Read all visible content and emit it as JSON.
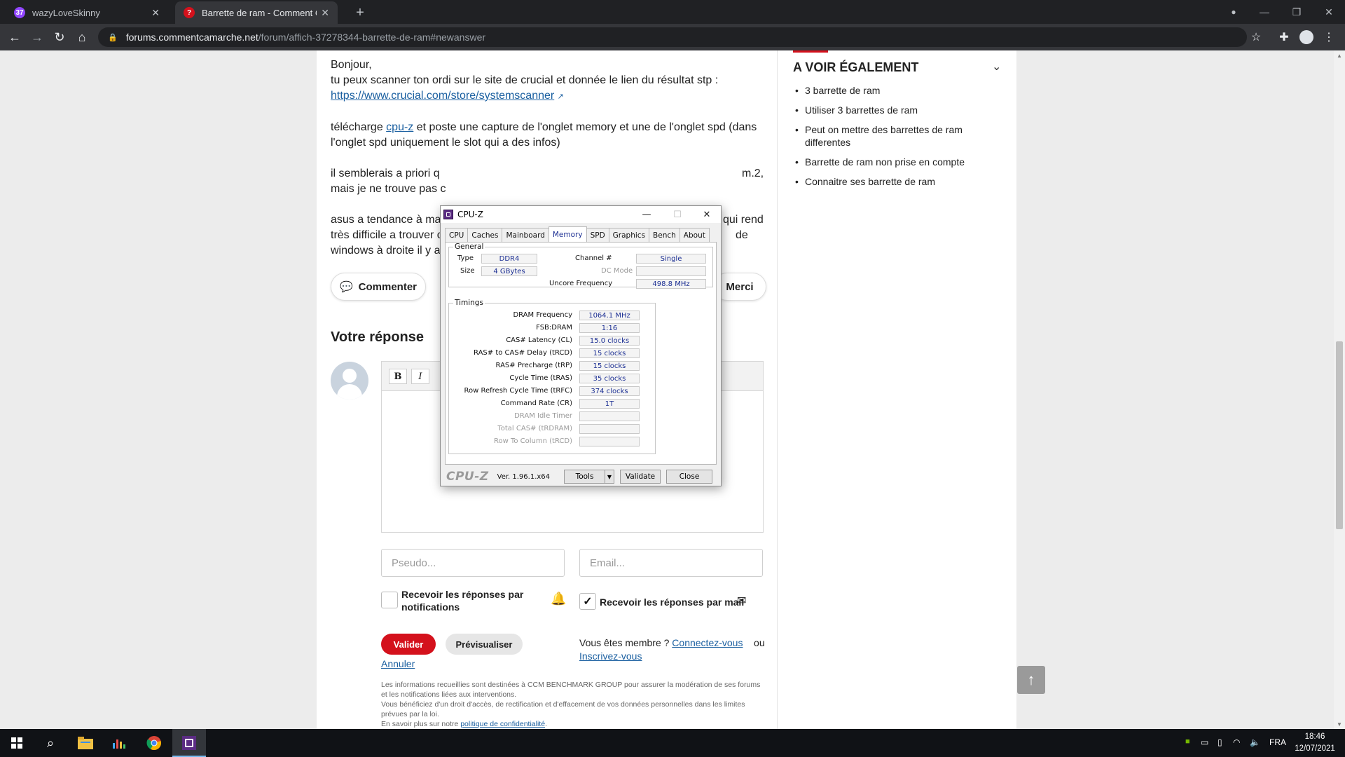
{
  "browser": {
    "tabs": [
      {
        "title": "wazyLoveSkinny",
        "favicon": "twitch-favicon",
        "active": false
      },
      {
        "title": "Barrette de ram - Comment Ça M",
        "favicon": "ccm-favicon",
        "active": true
      }
    ],
    "url_host": "forums.commentcamarche.net",
    "url_path": "/forum/affich-37278344-barrette-de-ram#newanswer"
  },
  "post": {
    "greeting": "Bonjour,",
    "line1": "tu peux scanner ton ordi sur le site de crucial et donnée le lien du résultat stp :",
    "link1": "https://www.crucial.com/store/systemscanner",
    "p2_a": "télécharge ",
    "p2_link": "cpu-z",
    "p2_b": " et poste une capture de l'onglet memory et une de l'onglet spd (dans l'onglet spd uniquement le slot qui a des infos)",
    "p3_a": "il semblerais a priori q",
    "p3_b": "m.2,",
    "p3_c": "mais je ne trouve pas c",
    "p4_a": "asus a tendance à ma",
    "p4_b": "qui rend",
    "p4_c": "très difficile a trouver c",
    "p4_d": "de",
    "p4_e": "windows à droite il y a"
  },
  "actions": {
    "comment": "Commenter",
    "thanks": "Merci"
  },
  "reply": {
    "heading": "Votre réponse",
    "bold": "B",
    "italic": "I",
    "pseudo_placeholder": "Pseudo...",
    "email_placeholder": "Email...",
    "notif_label": "Recevoir les réponses par notifications",
    "mail_label": "Recevoir les réponses par mail",
    "mail_checked": true,
    "submit": "Valider",
    "preview": "Prévisualiser",
    "cancel": "Annuler",
    "member_text": "Vous êtes membre ? ",
    "login": "Connectez-vous",
    "or": "ou",
    "signup": "Inscrivez-vous",
    "legal1": "Les informations recueillies sont destinées à CCM BENCHMARK GROUP pour assurer la modération de ses forums et les notifications liées aux interventions.",
    "legal2": "Vous bénéficiez d'un droit d'accès, de rectification et d'effacement de vos données personnelles dans les limites prévues par la loi.",
    "legal3": "En savoir plus sur notre ",
    "privacy": "politique de confidentialité",
    "legal4": "."
  },
  "sidebar": {
    "title": "A VOIR ÉGALEMENT",
    "items": [
      "3 barrette de ram",
      "Utiliser 3 barrettes de ram",
      "Peut on mettre des barrettes de ram differentes",
      "Barrette de ram non prise en compte",
      "Connaitre ses barrette de ram"
    ]
  },
  "cpuz": {
    "title": "CPU-Z",
    "tabs": [
      "CPU",
      "Caches",
      "Mainboard",
      "Memory",
      "SPD",
      "Graphics",
      "Bench",
      "About"
    ],
    "active_tab": "Memory",
    "general_label": "General",
    "type_label": "Type",
    "type": "DDR4",
    "size_label": "Size",
    "size": "4 GBytes",
    "channel_label": "Channel #",
    "channel": "Single",
    "dcmode_label": "DC Mode",
    "dcmode": "",
    "uncore_label": "Uncore Frequency",
    "uncore": "498.8 MHz",
    "timings_label": "Timings",
    "timings": [
      {
        "label": "DRAM Frequency",
        "value": "1064.1 MHz",
        "enabled": true
      },
      {
        "label": "FSB:DRAM",
        "value": "1:16",
        "enabled": true
      },
      {
        "label": "CAS# Latency (CL)",
        "value": "15.0 clocks",
        "enabled": true
      },
      {
        "label": "RAS# to CAS# Delay (tRCD)",
        "value": "15 clocks",
        "enabled": true
      },
      {
        "label": "RAS# Precharge (tRP)",
        "value": "15 clocks",
        "enabled": true
      },
      {
        "label": "Cycle Time (tRAS)",
        "value": "35 clocks",
        "enabled": true
      },
      {
        "label": "Row Refresh Cycle Time (tRFC)",
        "value": "374 clocks",
        "enabled": true
      },
      {
        "label": "Command Rate (CR)",
        "value": "1T",
        "enabled": true
      },
      {
        "label": "DRAM Idle Timer",
        "value": "",
        "enabled": false
      },
      {
        "label": "Total CAS# (tRDRAM)",
        "value": "",
        "enabled": false
      },
      {
        "label": "Row To Column (tRCD)",
        "value": "",
        "enabled": false
      }
    ],
    "logo": "CPU-Z",
    "version": "Ver. 1.96.1.x64",
    "tools": "Tools",
    "validate": "Validate",
    "close": "Close"
  },
  "taskbar": {
    "lang": "FRA",
    "time": "18:46",
    "date": "12/07/2021"
  },
  "colors": {
    "accent_red": "#d4111c",
    "link_blue": "#1a5fa0",
    "cpuz_value_blue": "#1c2f93"
  }
}
